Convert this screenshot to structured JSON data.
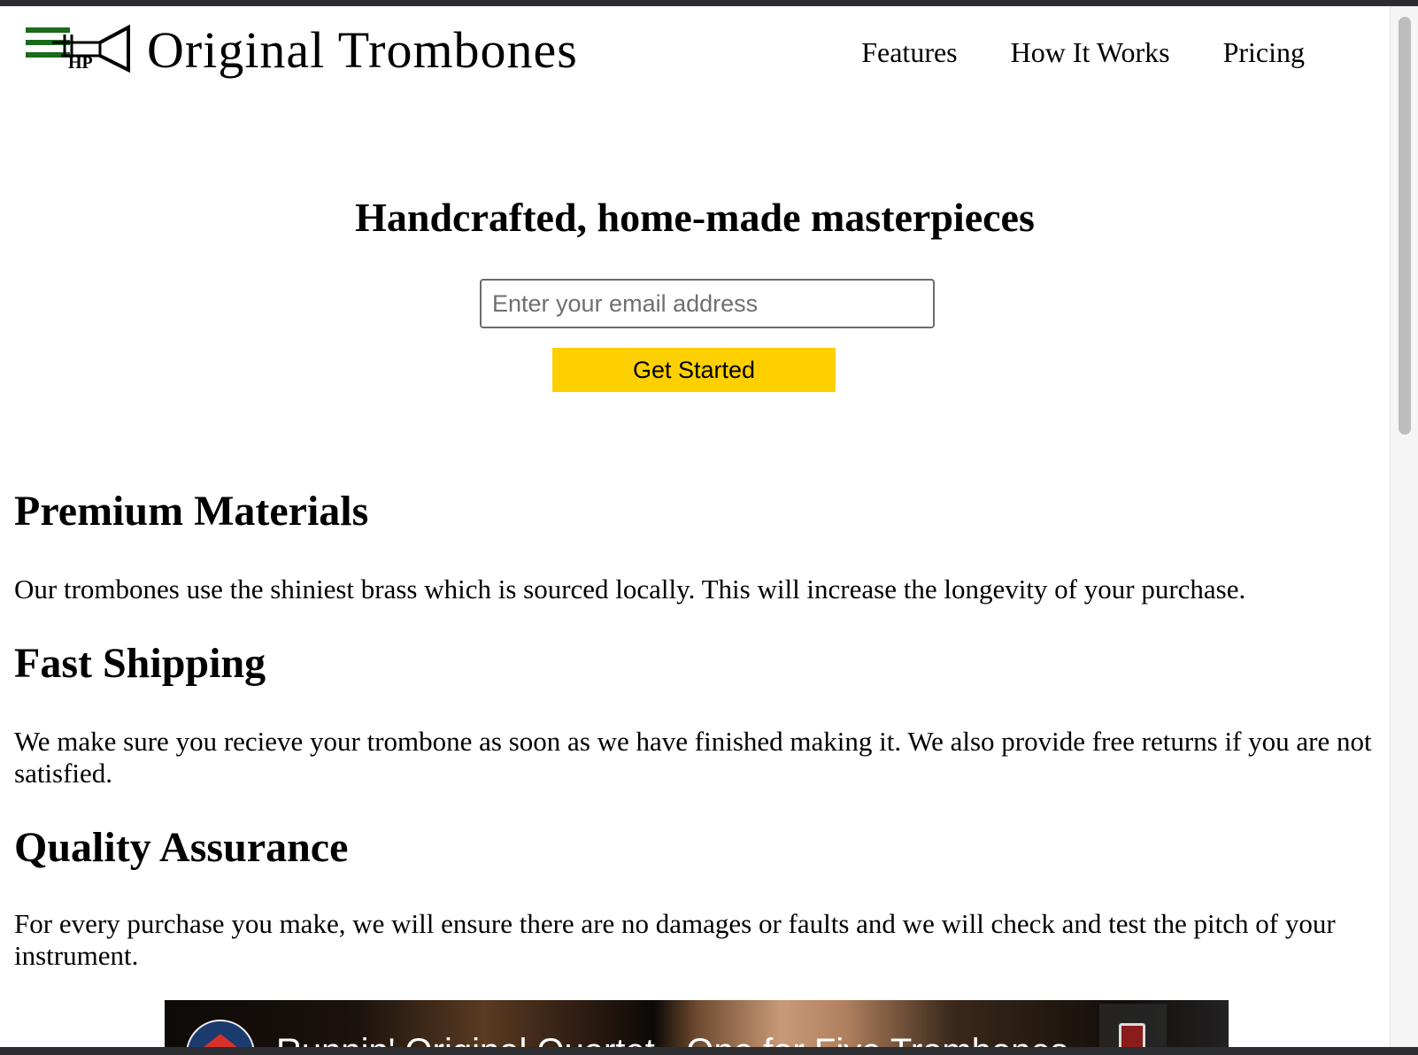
{
  "header": {
    "brand": "Original Trombones",
    "nav": [
      {
        "label": "Features"
      },
      {
        "label": "How It Works"
      },
      {
        "label": "Pricing"
      }
    ]
  },
  "hero": {
    "title": "Handcrafted, home-made masterpieces",
    "email_placeholder": "Enter your email address",
    "cta_label": "Get Started"
  },
  "features": [
    {
      "heading": "Premium Materials",
      "text": "Our trombones use the shiniest brass which is sourced locally. This will increase the longevity of your purchase."
    },
    {
      "heading": "Fast Shipping",
      "text": "We make sure you recieve your trombone as soon as we have finished making it. We also provide free returns if you are not satisfied."
    },
    {
      "heading": "Quality Assurance",
      "text": "For every purchase you make, we will ensure there are no damages or faults and we will check and test the pitch of your instrument."
    }
  ],
  "video": {
    "title": "Runnin' Original Quartet - One for Five Trombones"
  },
  "colors": {
    "cta": "#ffd000",
    "logo_green": "#1a6b1a"
  },
  "icons": {
    "logo": "trombone-logo-icon",
    "channel": "channel-avatar-icon",
    "copy": "copy-link-icon"
  }
}
